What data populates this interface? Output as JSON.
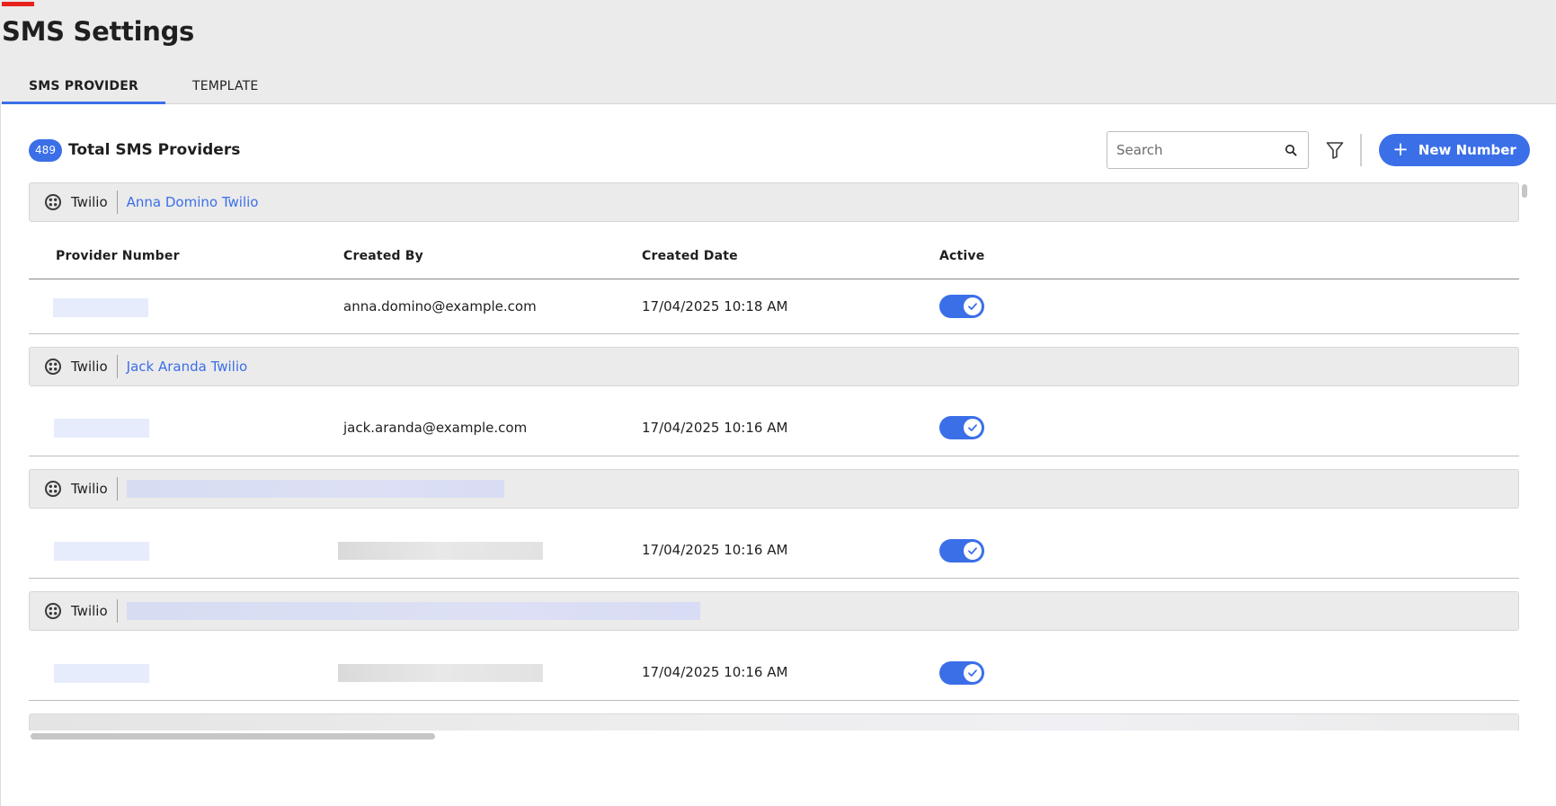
{
  "page": {
    "title": "SMS Settings",
    "accent_color": "#e8221c",
    "brand_color": "#3b6fe8"
  },
  "tabs": [
    {
      "label": "SMS PROVIDER",
      "active": true
    },
    {
      "label": "TEMPLATE",
      "active": false
    }
  ],
  "toolbar": {
    "total_count": "489",
    "total_label": "Total SMS Providers",
    "search_placeholder": "Search",
    "search_icon": "search-icon",
    "filter_icon": "filter-icon",
    "new_button_label": "New Number",
    "new_button_icon": "plus-icon"
  },
  "columns": {
    "provider_number": "Provider Number",
    "created_by": "Created By",
    "created_date": "Created Date",
    "active": "Active"
  },
  "providers": [
    {
      "type": "Twilio",
      "name": "Anna Domino Twilio",
      "created_by": "anna.domino@example.com",
      "created_date": "17/04/2025 10:18 AM",
      "active": true
    },
    {
      "type": "Twilio",
      "name": "Jack Aranda Twilio",
      "created_by": "jack.aranda@example.com",
      "created_date": "17/04/2025 10:16 AM",
      "active": true
    },
    {
      "type": "Twilio",
      "name": "",
      "created_by": "",
      "created_date": "17/04/2025 10:16 AM",
      "active": true
    },
    {
      "type": "Twilio",
      "name": "",
      "created_by": "",
      "created_date": "17/04/2025 10:16 AM",
      "active": true
    }
  ]
}
